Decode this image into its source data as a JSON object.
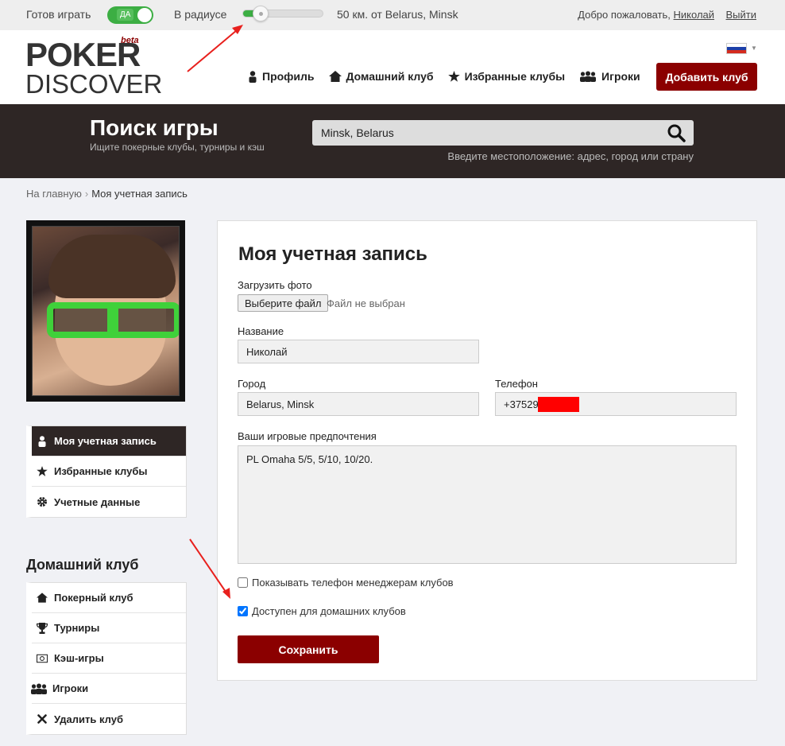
{
  "topbar": {
    "ready_label": "Готов играть",
    "toggle_label": "ДА",
    "radius_label": "В радиусе",
    "radius_value": 0.18,
    "distance_text": "50 км. от Belarus, Minsk",
    "welcome_text": "Добро пожаловать,",
    "user_name": "Николай",
    "logout": "Выйти"
  },
  "header": {
    "logo_top": "POKER",
    "logo_bottom": "DISCOVER",
    "logo_beta": "beta",
    "nav": [
      {
        "label": "Профиль",
        "icon": "person-icon"
      },
      {
        "label": "Домашний клуб",
        "icon": "home-icon"
      },
      {
        "label": "Избранные клубы",
        "icon": "star-icon"
      },
      {
        "label": "Игроки",
        "icon": "group-icon"
      }
    ],
    "add_club": "Добавить клуб",
    "language_flag": "russia-flag-icon"
  },
  "search": {
    "title": "Поиск игры",
    "subtitle": "Ищите покерные клубы, турниры и кэш",
    "value": "Minsk, Belarus",
    "hint": "Введите местоположение: адрес, город или страну"
  },
  "breadcrumb": {
    "home": "На главную",
    "separator": "›",
    "current": "Моя учетная запись"
  },
  "account_menu": [
    {
      "label": "Моя учетная запись",
      "icon": "person-icon",
      "active": true
    },
    {
      "label": "Избранные клубы",
      "icon": "star-icon",
      "active": false
    },
    {
      "label": "Учетные данные",
      "icon": "gear-icon",
      "active": false
    }
  ],
  "home_club": {
    "title": "Домашний клуб",
    "items": [
      {
        "label": "Покерный клуб",
        "icon": "home-icon"
      },
      {
        "label": "Турниры",
        "icon": "trophy-icon"
      },
      {
        "label": "Кэш-игры",
        "icon": "cash-icon"
      },
      {
        "label": "Игроки",
        "icon": "group-icon"
      },
      {
        "label": "Удалить клуб",
        "icon": "close-icon"
      }
    ]
  },
  "form": {
    "title": "Моя учетная запись",
    "photo_label": "Загрузить фото",
    "file_button": "Выберите файл",
    "file_status": "Файл не выбран",
    "name_label": "Название",
    "name_value": "Николай",
    "city_label": "Город",
    "city_value": "Belarus, Minsk",
    "phone_label": "Телефон",
    "phone_value": "+37529",
    "prefs_label": "Ваши игровые предпочтения",
    "prefs_value": "PL Omaha 5/5, 5/10, 10/20.",
    "show_phone_label": "Показывать телефон менеджерам клубов",
    "show_phone_checked": false,
    "available_label": "Доступен для домашних клубов",
    "available_checked": true,
    "save": "Сохранить"
  },
  "colors": {
    "brand": "#8b0000",
    "dark_band": "#2e2625",
    "toggle_green": "#3cae43",
    "annotation_arrow": "#e8201d"
  }
}
